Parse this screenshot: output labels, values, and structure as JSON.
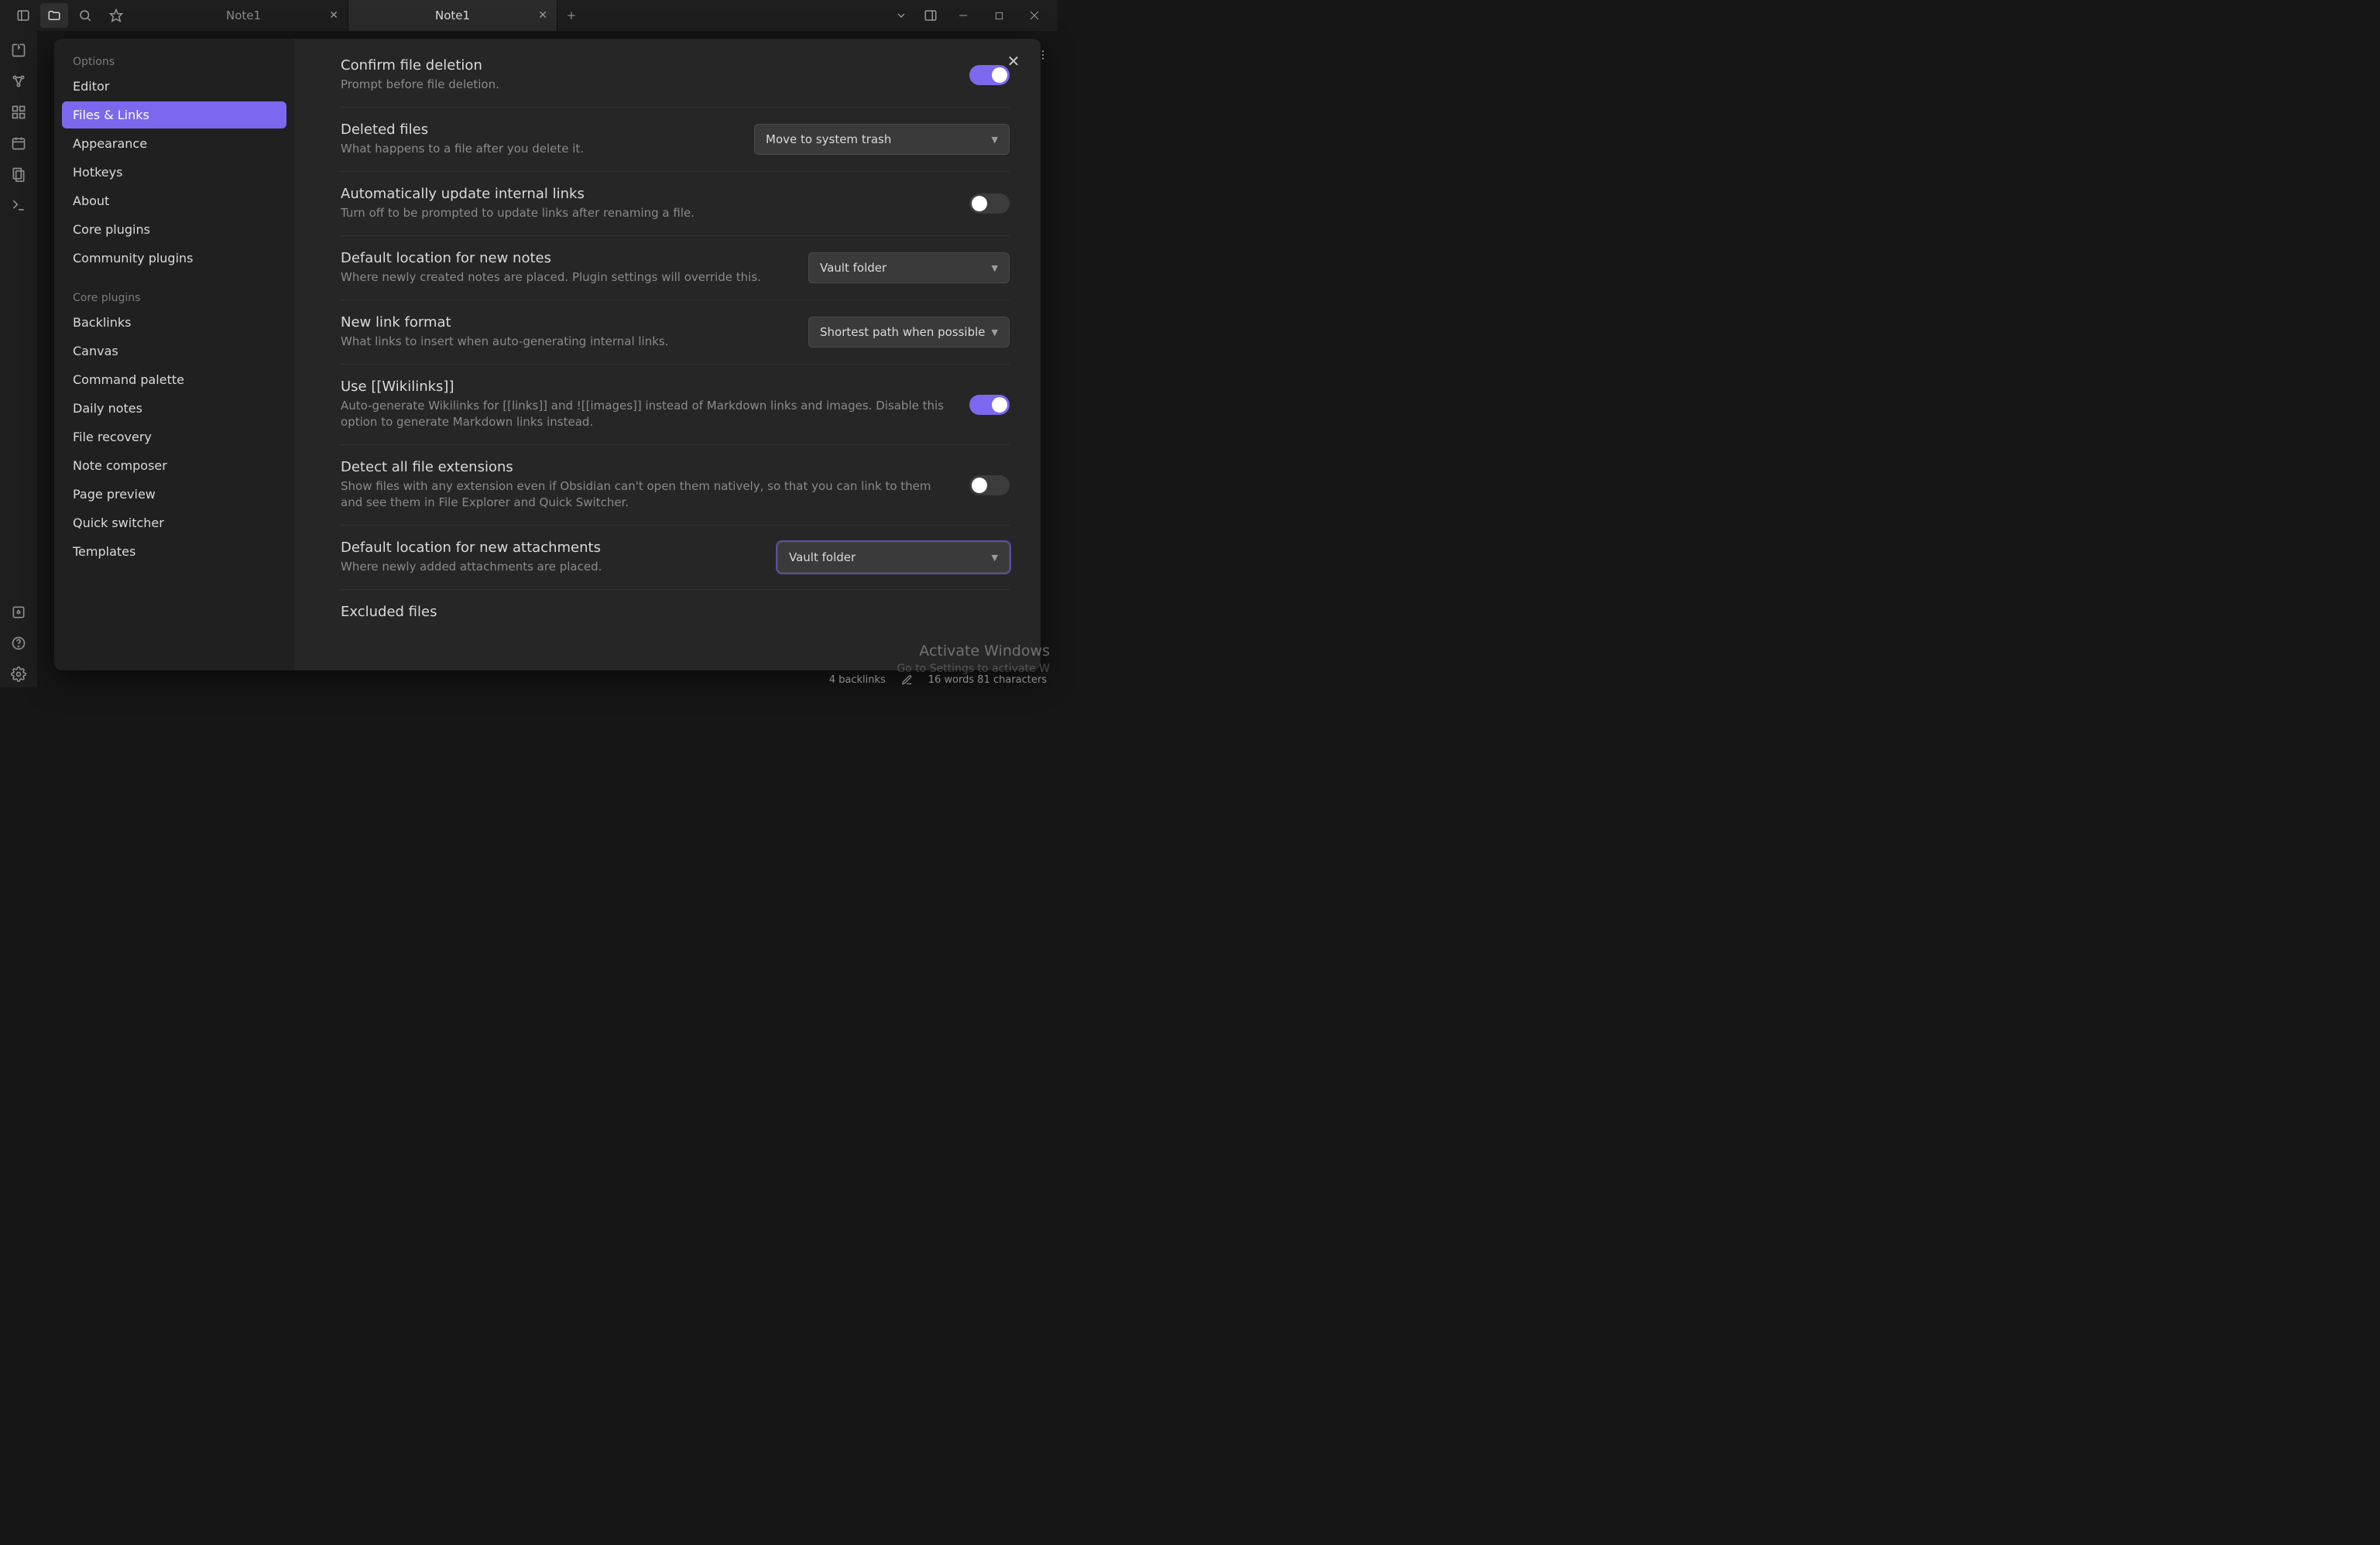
{
  "tabs": [
    {
      "label": "Note1",
      "active": false
    },
    {
      "label": "Note1",
      "active": true
    }
  ],
  "settings_nav": {
    "group1_title": "Options",
    "group1_items": [
      "Editor",
      "Files & Links",
      "Appearance",
      "Hotkeys",
      "About",
      "Core plugins",
      "Community plugins"
    ],
    "group1_active_index": 1,
    "group2_title": "Core plugins",
    "group2_items": [
      "Backlinks",
      "Canvas",
      "Command palette",
      "Daily notes",
      "File recovery",
      "Note composer",
      "Page preview",
      "Quick switcher",
      "Templates"
    ]
  },
  "settings": {
    "confirm_delete": {
      "title": "Confirm file deletion",
      "desc": "Prompt before file deletion.",
      "value": true
    },
    "deleted_files": {
      "title": "Deleted files",
      "desc": "What happens to a file after you delete it.",
      "value": "Move to system trash"
    },
    "auto_update_links": {
      "title": "Automatically update internal links",
      "desc": "Turn off to be prompted to update links after renaming a file.",
      "value": false
    },
    "new_note_location": {
      "title": "Default location for new notes",
      "desc": "Where newly created notes are placed. Plugin settings will override this.",
      "value": "Vault folder"
    },
    "new_link_format": {
      "title": "New link format",
      "desc": "What links to insert when auto-generating internal links.",
      "value": "Shortest path when possible"
    },
    "use_wikilinks": {
      "title": "Use [[Wikilinks]]",
      "desc": "Auto-generate Wikilinks for [[links]] and ![[images]] instead of Markdown links and images. Disable this option to generate Markdown links instead.",
      "value": true
    },
    "detect_extensions": {
      "title": "Detect all file extensions",
      "desc": "Show files with any extension even if Obsidian can't open them natively, so that you can link to them and see them in File Explorer and Quick Switcher.",
      "value": false
    },
    "attachment_location": {
      "title": "Default location for new attachments",
      "desc": "Where newly added attachments are placed.",
      "value": "Vault folder"
    },
    "excluded_files": {
      "title": "Excluded files"
    }
  },
  "status": {
    "backlinks": "4 backlinks",
    "wordcount": "16 words   81 characters"
  },
  "watermark": {
    "title": "Activate Windows",
    "sub": "Go to Settings to activate W"
  }
}
